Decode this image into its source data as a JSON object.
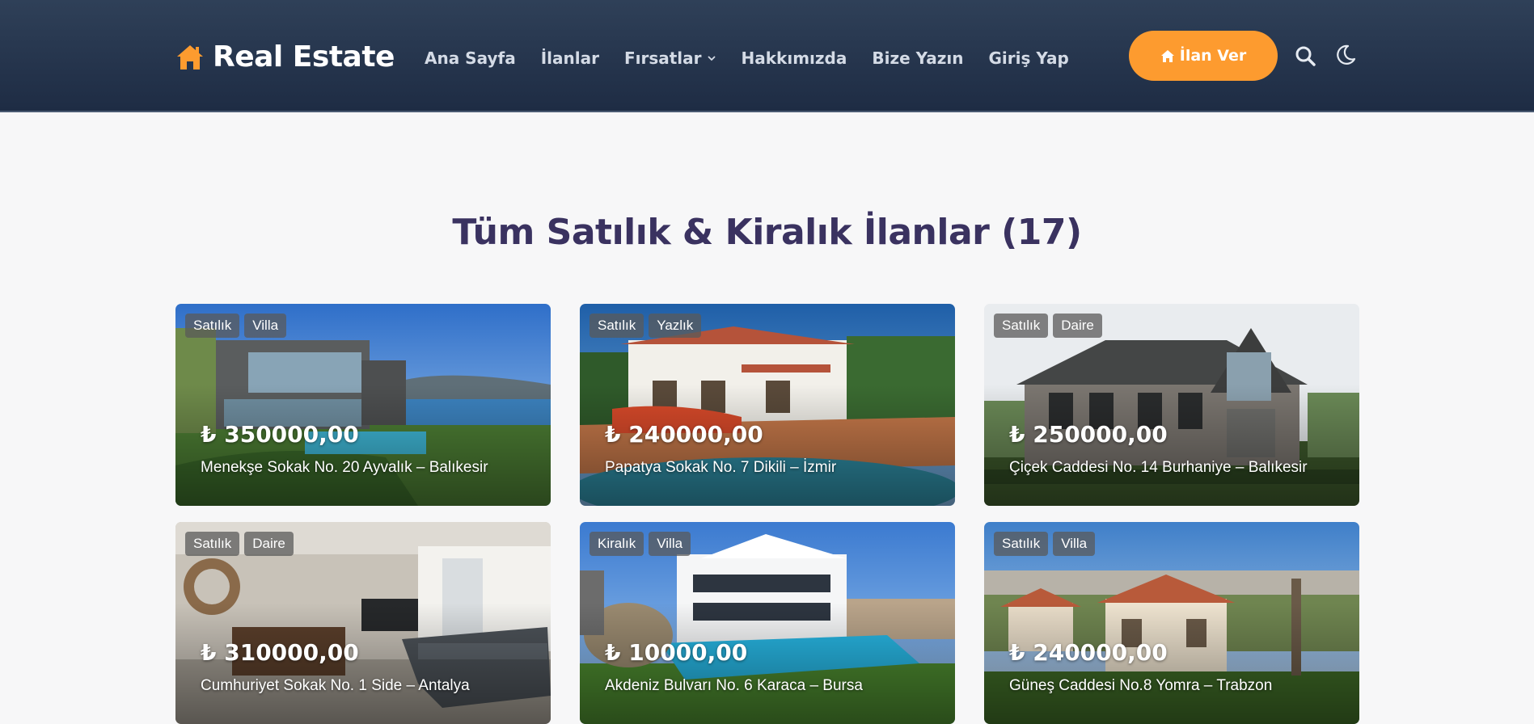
{
  "brand": {
    "name": "Real Estate",
    "accent": "#fd9b2f"
  },
  "nav": {
    "links": [
      {
        "label": "Ana Sayfa"
      },
      {
        "label": "İlanlar"
      },
      {
        "label": "Fırsatlar",
        "dropdown": true
      },
      {
        "label": "Hakkımızda"
      },
      {
        "label": "Bize Yazın"
      },
      {
        "label": "Giriş Yap"
      }
    ],
    "cta_label": "İlan Ver",
    "cta_icon": "home-icon",
    "search_icon": "search-icon",
    "theme_icon": "moon-icon"
  },
  "page": {
    "title": "Tüm Satılık & Kiralık İlanlar (17)"
  },
  "listings": [
    {
      "status": "Satılık",
      "type": "Villa",
      "price": "₺ 350000,00",
      "address": "Menekşe Sokak No. 20 Ayvalık – Balıkesir"
    },
    {
      "status": "Satılık",
      "type": "Yazlık",
      "price": "₺ 240000,00",
      "address": "Papatya Sokak No. 7 Dikili – İzmir"
    },
    {
      "status": "Satılık",
      "type": "Daire",
      "price": "₺ 250000,00",
      "address": "Çiçek Caddesi No. 14 Burhaniye – Balıkesir"
    },
    {
      "status": "Satılık",
      "type": "Daire",
      "price": "₺ 310000,00",
      "address": "Cumhuriyet Sokak No. 1 Side – Antalya"
    },
    {
      "status": "Kiralık",
      "type": "Villa",
      "price": "₺ 10000,00",
      "address": "Akdeniz Bulvarı No. 6 Karaca – Bursa"
    },
    {
      "status": "Satılık",
      "type": "Villa",
      "price": "₺ 240000,00",
      "address": "Güneş Caddesi No.8 Yomra – Trabzon"
    }
  ]
}
